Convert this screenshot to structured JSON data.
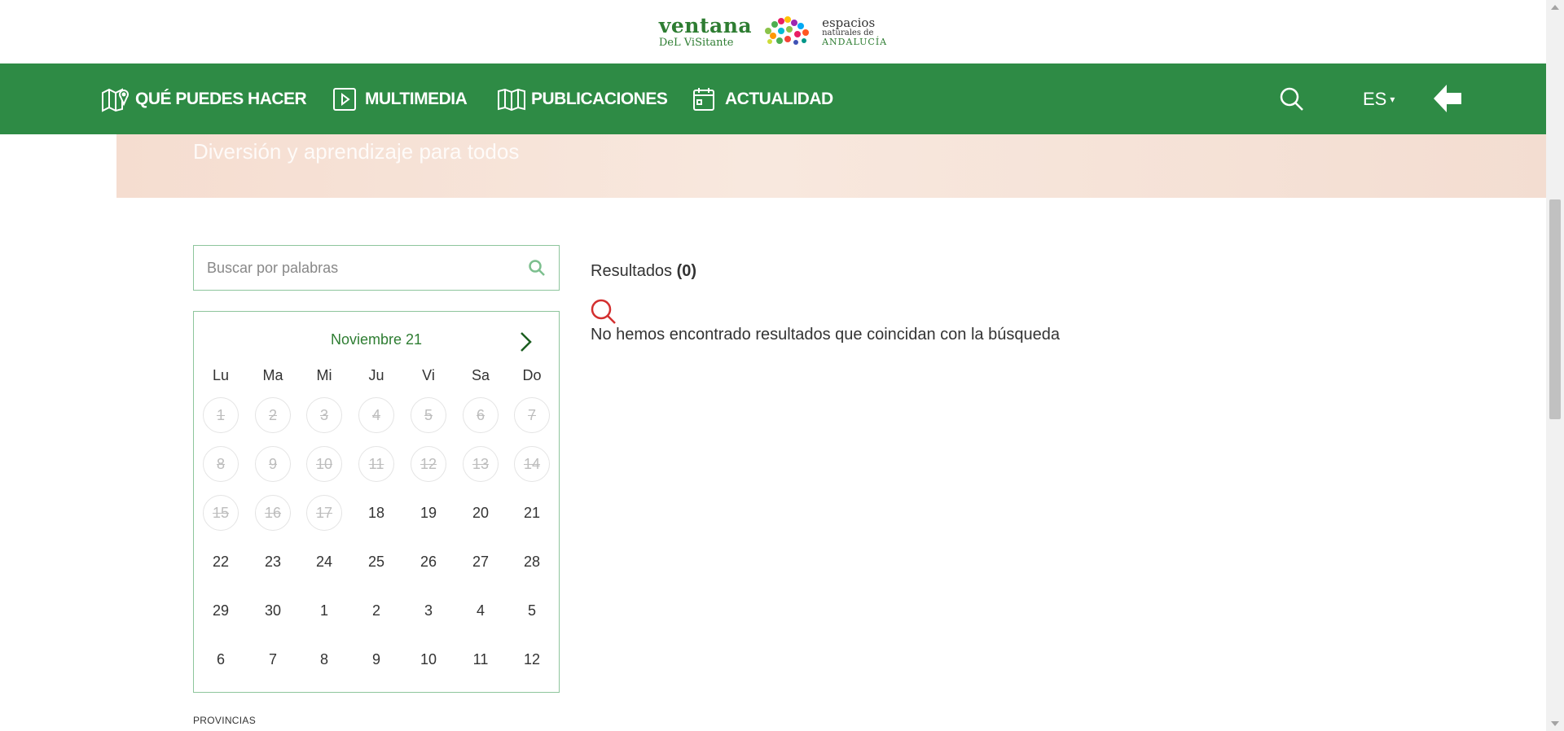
{
  "logo": {
    "line1": "ventana",
    "line2": "DeL ViSitante",
    "right1": "espacios",
    "right2": "naturales de",
    "right3": "ANDALUCÍA"
  },
  "nav": {
    "items": [
      {
        "label": "QUÉ PUEDES HACER",
        "icon": "map-pin-icon"
      },
      {
        "label": "MULTIMEDIA",
        "icon": "play-icon"
      },
      {
        "label": "PUBLICACIONES",
        "icon": "book-icon"
      },
      {
        "label": "ACTUALIDAD",
        "icon": "calendar-icon"
      }
    ],
    "language": "ES",
    "search_icon": "search-icon",
    "back_icon": "arrow-left-icon"
  },
  "hero": {
    "subtitle": "Diversión y aprendizaje para todos"
  },
  "search": {
    "placeholder": "Buscar por palabras",
    "value": ""
  },
  "calendar": {
    "month_label": "Noviembre 21",
    "weekdays": [
      "Lu",
      "Ma",
      "Mi",
      "Ju",
      "Vi",
      "Sa",
      "Do"
    ],
    "weeks": [
      [
        {
          "d": "1",
          "off": true
        },
        {
          "d": "2",
          "off": true
        },
        {
          "d": "3",
          "off": true
        },
        {
          "d": "4",
          "off": true
        },
        {
          "d": "5",
          "off": true
        },
        {
          "d": "6",
          "off": true
        },
        {
          "d": "7",
          "off": true
        }
      ],
      [
        {
          "d": "8",
          "off": true
        },
        {
          "d": "9",
          "off": true
        },
        {
          "d": "10",
          "off": true
        },
        {
          "d": "11",
          "off": true
        },
        {
          "d": "12",
          "off": true
        },
        {
          "d": "13",
          "off": true
        },
        {
          "d": "14",
          "off": true
        }
      ],
      [
        {
          "d": "15",
          "off": true
        },
        {
          "d": "16",
          "off": true
        },
        {
          "d": "17",
          "off": true
        },
        {
          "d": "18",
          "off": false
        },
        {
          "d": "19",
          "off": false
        },
        {
          "d": "20",
          "off": false
        },
        {
          "d": "21",
          "off": false
        }
      ],
      [
        {
          "d": "22",
          "off": false
        },
        {
          "d": "23",
          "off": false
        },
        {
          "d": "24",
          "off": false
        },
        {
          "d": "25",
          "off": false
        },
        {
          "d": "26",
          "off": false
        },
        {
          "d": "27",
          "off": false
        },
        {
          "d": "28",
          "off": false
        }
      ],
      [
        {
          "d": "29",
          "off": false
        },
        {
          "d": "30",
          "off": false
        },
        {
          "d": "1",
          "off": false
        },
        {
          "d": "2",
          "off": false
        },
        {
          "d": "3",
          "off": false
        },
        {
          "d": "4",
          "off": false
        },
        {
          "d": "5",
          "off": false
        }
      ],
      [
        {
          "d": "6",
          "off": false
        },
        {
          "d": "7",
          "off": false
        },
        {
          "d": "8",
          "off": false
        },
        {
          "d": "9",
          "off": false
        },
        {
          "d": "10",
          "off": false
        },
        {
          "d": "11",
          "off": false
        },
        {
          "d": "12",
          "off": false
        }
      ]
    ]
  },
  "results": {
    "label": "Resultados",
    "count": "(0)",
    "empty_message": "No hemos encontrado resultados que coincidan con la búsqueda"
  },
  "filters": {
    "provincias_label": "PROVINCIAS"
  },
  "colors": {
    "brand_green": "#2e8b45",
    "accent_red": "#d32f2f"
  }
}
